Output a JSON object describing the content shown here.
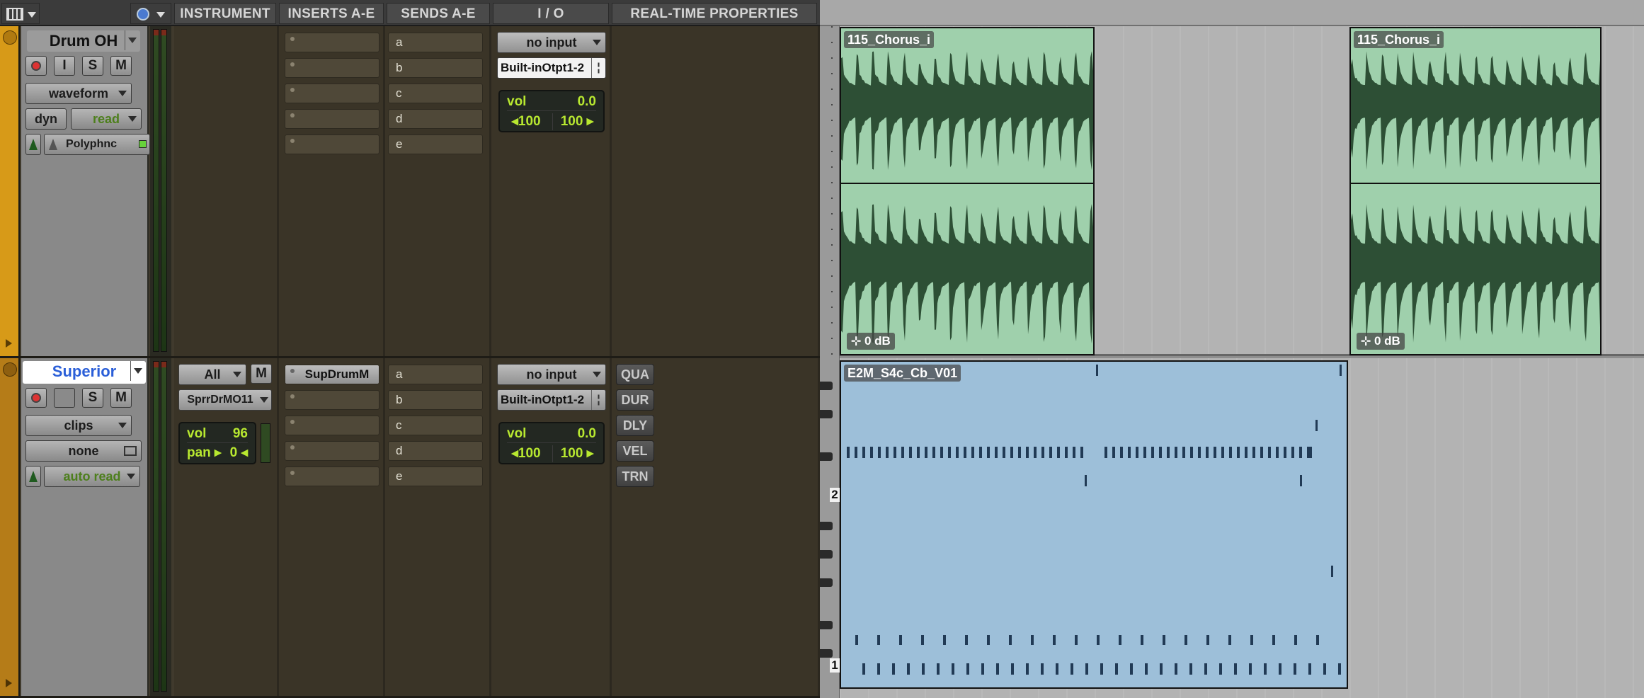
{
  "header": {
    "instrument": "INSTRUMENT",
    "inserts": "INSERTS A-E",
    "sends": "SENDS A-E",
    "io": "I / O",
    "rtp": "REAL-TIME PROPERTIES"
  },
  "colors": {
    "track1": "#d79a18",
    "track2": "#b57c18",
    "audio_clip": "#9fd0ac",
    "midi_clip": "#9dbfd9",
    "lcd_text": "#b8e830"
  },
  "tracks": [
    {
      "name": "Drum OH",
      "buttons": {
        "rec": "",
        "input": "I",
        "solo": "S",
        "mute": "M"
      },
      "view": "waveform",
      "dyn": "dyn",
      "automation": "read",
      "elastic": "Polyphnc",
      "sends": [
        "a",
        "b",
        "c",
        "d",
        "e"
      ],
      "io": {
        "input": "no input",
        "output": "Built-inOtpt1-2",
        "vol_label": "vol",
        "vol_value": "0.0",
        "pan_left": "100",
        "pan_right": "100"
      },
      "clips": [
        {
          "name": "115_Chorus_i",
          "gain": "0 dB"
        },
        {
          "name": "115_Chorus_i",
          "gain": "0 dB"
        }
      ]
    },
    {
      "name": "Superior",
      "buttons": {
        "rec": "",
        "input": "",
        "solo": "S",
        "mute": "M"
      },
      "view": "clips",
      "dyn": "none",
      "automation": "auto read",
      "instrument": {
        "channel": "All",
        "mute": "M",
        "plugin": "SprrDrMO11",
        "vol_label": "vol",
        "vol_value": "96",
        "pan_label": "pan",
        "pan_value": "0"
      },
      "inserts": [
        "SupDrumM",
        "",
        "",
        "",
        ""
      ],
      "sends": [
        "a",
        "b",
        "c",
        "d",
        "e"
      ],
      "io": {
        "input": "no input",
        "output": "Built-inOtpt1-2",
        "vol_label": "vol",
        "vol_value": "0.0",
        "pan_left": "100",
        "pan_right": "100"
      },
      "realtime": [
        "QUA",
        "DUR",
        "DLY",
        "VEL",
        "TRN"
      ],
      "clips": [
        {
          "name": "E2M_S4c_Cb_V01"
        }
      ],
      "octave_labels": [
        "2",
        "1"
      ]
    }
  ]
}
